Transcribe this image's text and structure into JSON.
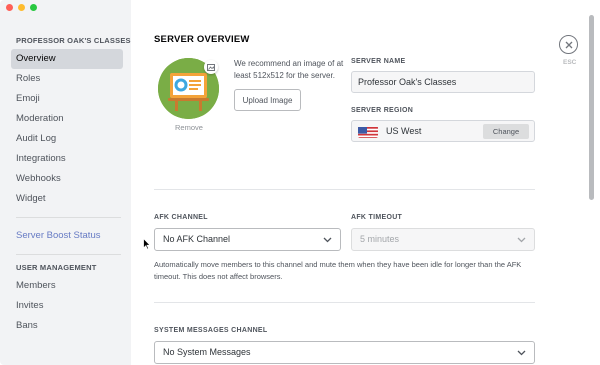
{
  "sidebar": {
    "server_header": "PROFESSOR OAK'S CLASSES",
    "items": [
      {
        "label": "Overview"
      },
      {
        "label": "Roles"
      },
      {
        "label": "Emoji"
      },
      {
        "label": "Moderation"
      },
      {
        "label": "Audit Log"
      },
      {
        "label": "Integrations"
      },
      {
        "label": "Webhooks"
      },
      {
        "label": "Widget"
      }
    ],
    "boost_label": "Server Boost Status",
    "user_mgmt_header": "USER MANAGEMENT",
    "user_items": [
      {
        "label": "Members"
      },
      {
        "label": "Invites"
      },
      {
        "label": "Bans"
      }
    ]
  },
  "main": {
    "title": "SERVER OVERVIEW",
    "remove_label": "Remove",
    "recommend_text": "We recommend an image of at least 512x512 for the server.",
    "upload_label": "Upload Image",
    "server_name_label": "SERVER NAME",
    "server_name_value": "Professor Oak's Classes",
    "server_region_label": "SERVER REGION",
    "region_value": "US West",
    "change_label": "Change",
    "afk_channel_label": "AFK CHANNEL",
    "afk_channel_value": "No AFK Channel",
    "afk_timeout_label": "AFK TIMEOUT",
    "afk_timeout_value": "5 minutes",
    "afk_help": "Automatically move members to this channel and mute them when they have been idle for longer than the AFK timeout. This does not affect browsers.",
    "system_channel_label": "SYSTEM MESSAGES CHANNEL",
    "system_channel_value": "No System Messages",
    "esc_label": "ESC"
  },
  "colors": {
    "sidebar_bg": "#f2f3f5",
    "active_item": "#d4d7dc",
    "boost_link": "#677bc4",
    "avatar_green": "#7aad46"
  },
  "icons": [
    "close-icon",
    "chevron-down-icon",
    "add-image-icon",
    "us-flag-icon",
    "mouse-cursor-icon"
  ]
}
